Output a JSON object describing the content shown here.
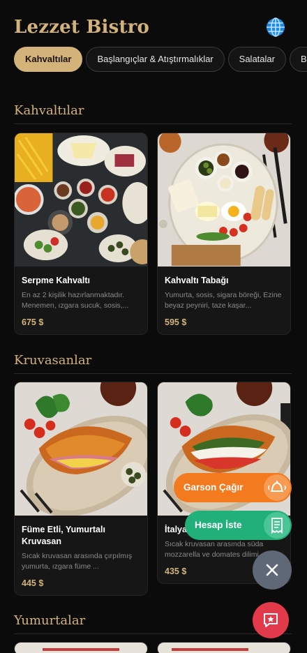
{
  "header": {
    "title": "Lezzet Bistro",
    "language_icon": "globe-icon"
  },
  "tabs": [
    {
      "label": "Kahvaltılar",
      "active": true
    },
    {
      "label": "Başlangıçlar & Atıştırmalıklar",
      "active": false
    },
    {
      "label": "Salatalar",
      "active": false
    },
    {
      "label": "B",
      "active": false
    }
  ],
  "sections": [
    {
      "title": "Kahvaltılar",
      "items": [
        {
          "name": "Serpme Kahvaltı",
          "description": "En az 2 kişilik hazırlanmaktadır. Menemen, ızgara sucuk, sosis,...",
          "price": "675 $"
        },
        {
          "name": "Kahvaltı Tabağı",
          "description": "Yumurta, sosis, sigara böreği, Ezine beyaz peyniri, taze kaşar...",
          "price": "595 $"
        }
      ]
    },
    {
      "title": "Kruvasanlar",
      "items": [
        {
          "name": "Füme Etli, Yumurtalı Kruvasan",
          "description": "Sıcak kruvasan arasında çırpılmış yumurta, ızgara füme ...",
          "price": "445 $"
        },
        {
          "name": "İtalyan Kruvasan",
          "description": "Sıcak kruvasan arasında süda mozzarella ve domates dilimi...",
          "price": "435 $"
        }
      ]
    },
    {
      "title": "Yumurtalar",
      "items": []
    }
  ],
  "actions": {
    "call_waiter": "Garson Çağır",
    "request_bill": "Hesap İste",
    "close_icon": "close-icon",
    "feedback_icon": "chat-star-icon"
  },
  "colors": {
    "accent_gold": "#d4b37a",
    "waiter_orange": "#f47a20",
    "bill_green": "#22b07a",
    "close_gray": "#5f6877",
    "feedback_red": "#e23a4a"
  }
}
